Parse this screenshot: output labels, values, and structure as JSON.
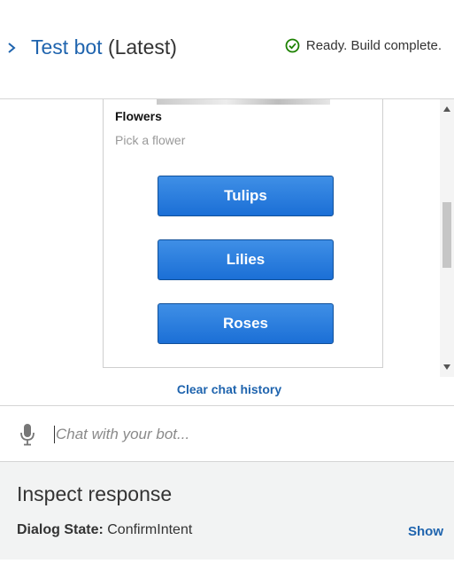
{
  "header": {
    "bot_name": "Test bot",
    "version": "(Latest)",
    "status_text": "Ready. Build complete.",
    "status_color": "#1d8102"
  },
  "card": {
    "title": "Flowers",
    "subtitle": "Pick a flower",
    "options": [
      {
        "label": "Tulips"
      },
      {
        "label": "Lilies"
      },
      {
        "label": "Roses"
      }
    ]
  },
  "chat": {
    "clear_label": "Clear chat history",
    "input_placeholder": "Chat with your bot...",
    "input_value": ""
  },
  "inspect": {
    "title": "Inspect response",
    "dialog_state_label": "Dialog State:",
    "dialog_state_value": "ConfirmIntent",
    "show_label": "Show"
  },
  "colors": {
    "accent": "#1f64ae",
    "button": "#1b6fd6"
  }
}
